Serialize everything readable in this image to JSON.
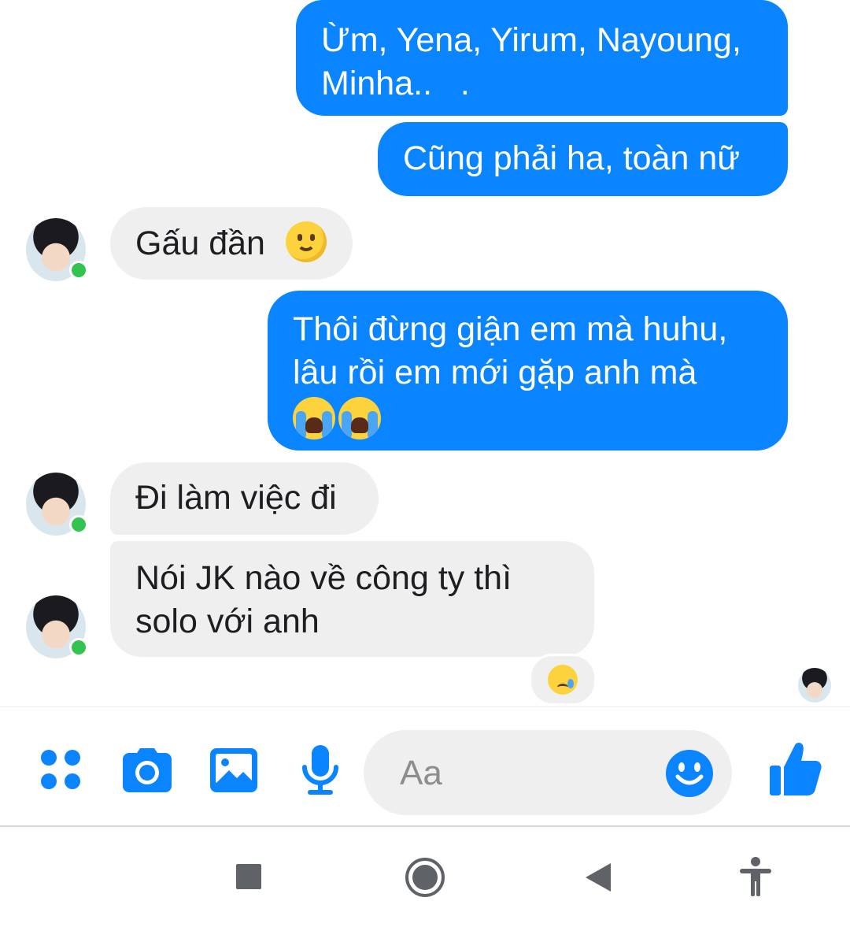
{
  "colors": {
    "outgoing_bubble": "#0a84ff",
    "incoming_bubble": "#efefef",
    "accent": "#0a84ff",
    "online_dot": "#31c44f"
  },
  "messages": [
    {
      "direction": "outgoing",
      "lines": [
        "Ừm, Yena, Yirum, Nayoung,",
        "Minha..   ."
      ]
    },
    {
      "direction": "outgoing",
      "lines": [
        "Cũng phải ha, toàn nữ"
      ]
    },
    {
      "direction": "incoming",
      "lines": [
        "Gấu đần"
      ],
      "emoji": "slightly-smiling-face"
    },
    {
      "direction": "outgoing",
      "lines": [
        "Thôi đừng giận em mà huhu,",
        "lâu rồi em mới gặp anh mà"
      ],
      "emoji": "loudly-crying-face x2"
    },
    {
      "direction": "incoming",
      "lines": [
        "Đi làm việc đi"
      ]
    },
    {
      "direction": "incoming",
      "lines": [
        "Nói JK nào về công ty thì",
        "solo với anh"
      ],
      "reaction": "crying-face"
    }
  ],
  "composer": {
    "placeholder": "Aa",
    "icons": [
      "apps-icon",
      "camera-icon",
      "gallery-icon",
      "microphone-icon",
      "emoji-icon",
      "thumbs-up-icon"
    ]
  },
  "navigation_bar": {
    "icons": [
      "recents-square-icon",
      "home-circle-icon",
      "back-triangle-icon",
      "accessibility-icon"
    ]
  }
}
